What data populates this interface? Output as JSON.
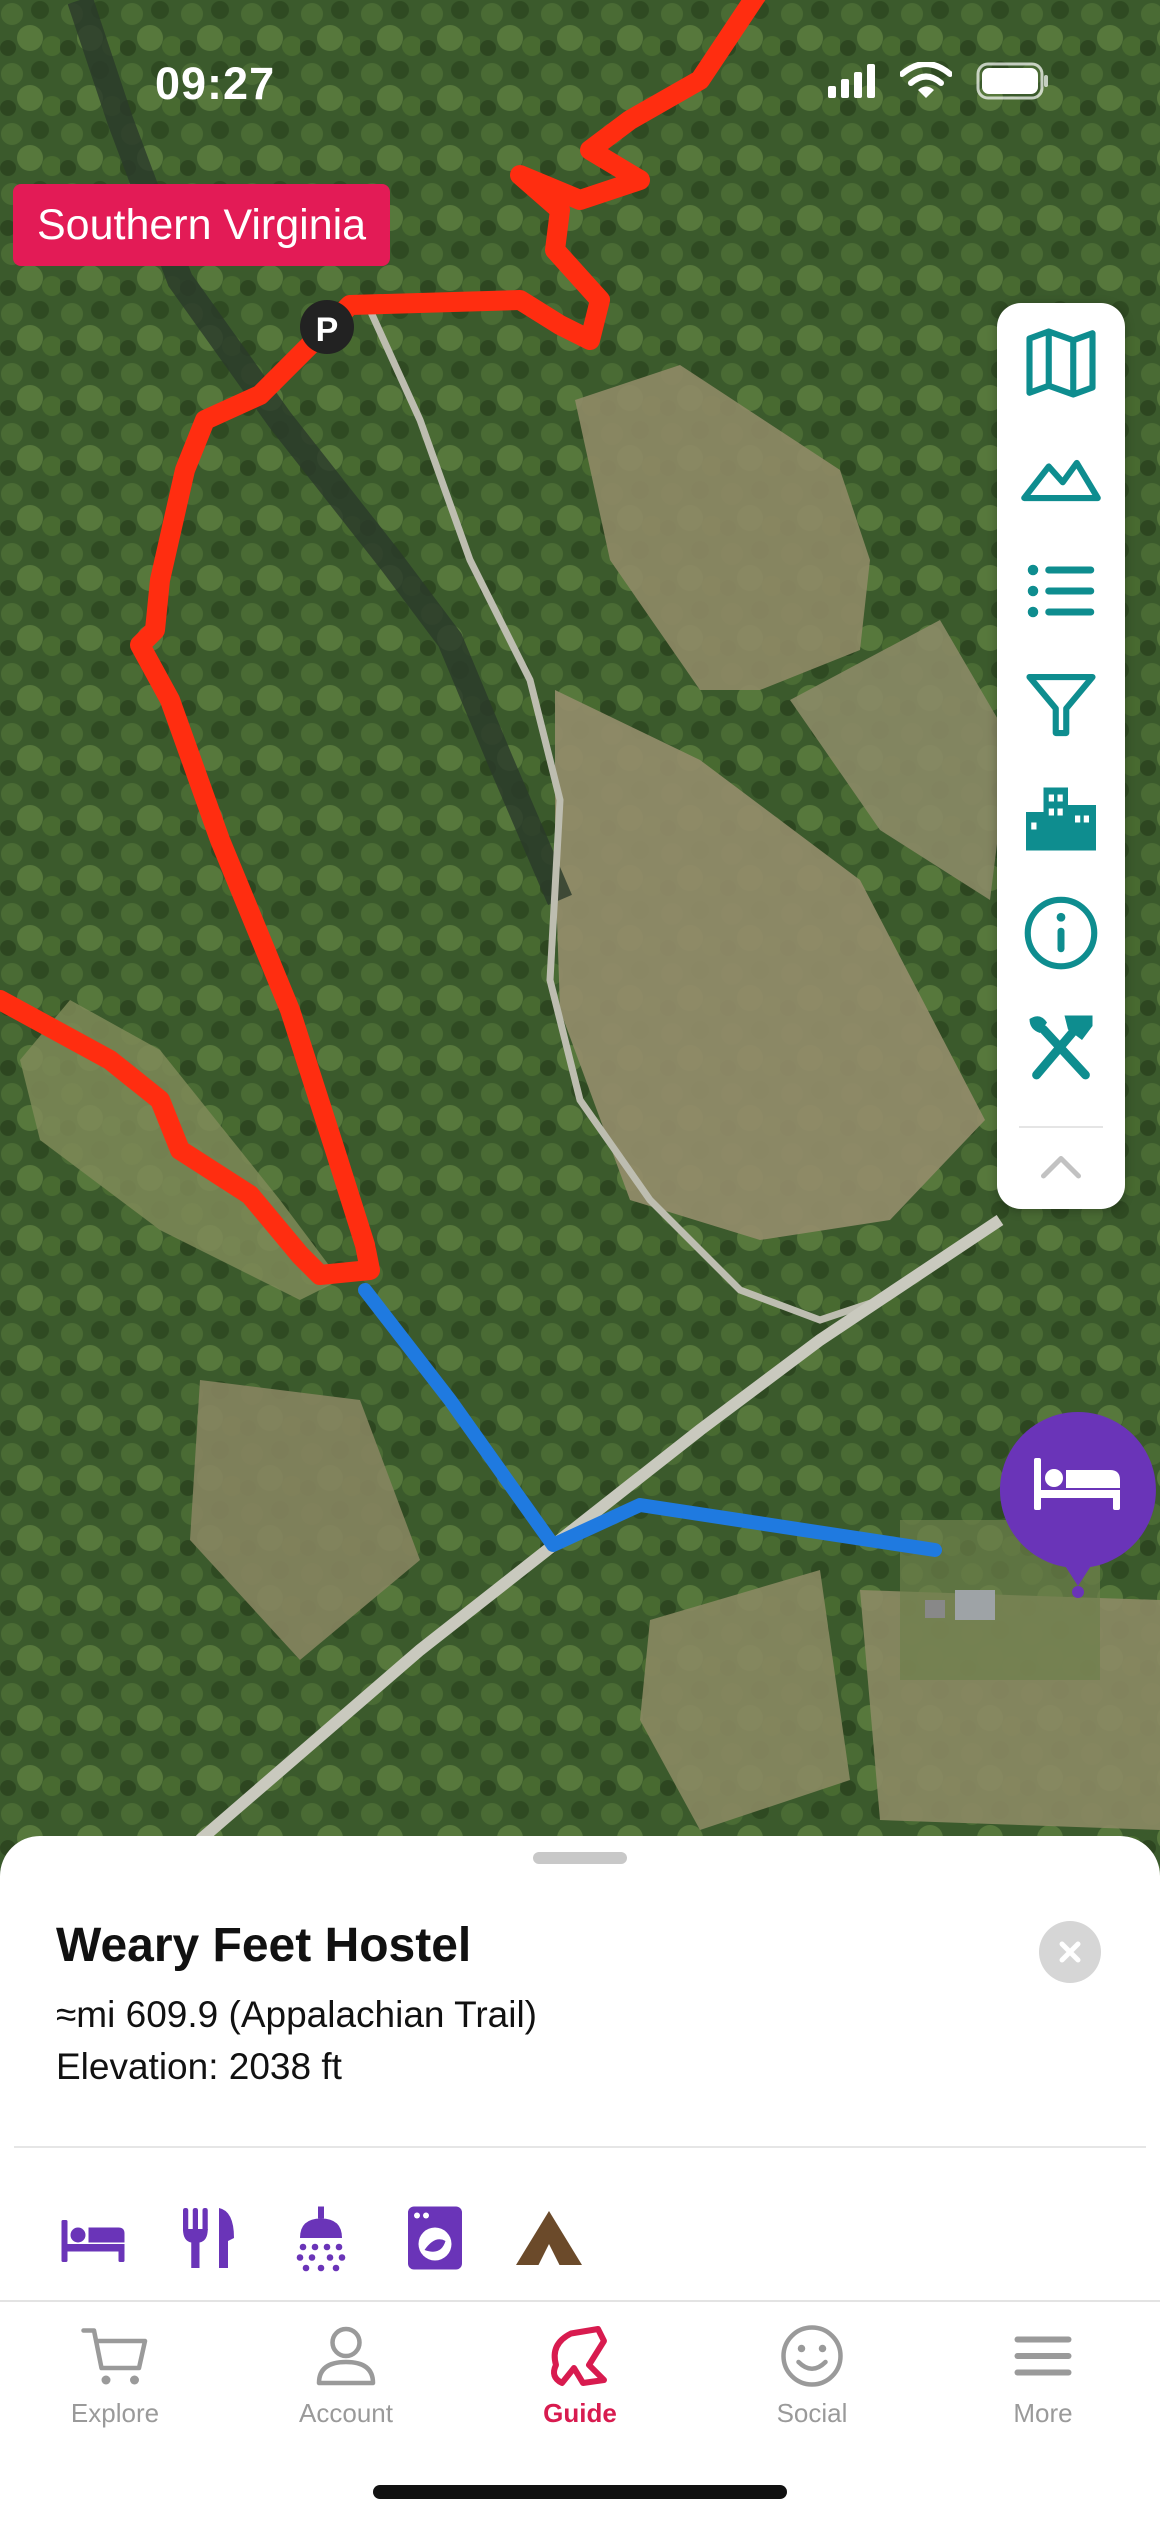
{
  "status_bar": {
    "time": "09:27"
  },
  "map": {
    "region_label": "Southern Virginia",
    "parking_marker": "P",
    "trail_color": "#ff2d10",
    "route_color": "#1f7ae0",
    "poi_pin_icon": "bed-icon",
    "poi_pin_color": "#6a34b8"
  },
  "toolbar": {
    "items": [
      "map-icon",
      "elevation-icon",
      "list-icon",
      "filter-icon",
      "buildings-icon",
      "info-icon",
      "tools-icon",
      "chevron-up-icon"
    ],
    "color": "#0e8d8f"
  },
  "poi": {
    "title": "Weary Feet Hostel",
    "mile": "≈mi 609.9 (Appalachian Trail)",
    "elevation": "Elevation: 2038 ft",
    "amenities": [
      "bed-icon",
      "fork-knife-icon",
      "shower-icon",
      "laundry-icon",
      "tent-icon"
    ],
    "amenity_color": "#6a34b8",
    "tent_color": "#6b4a2a"
  },
  "tabbar": {
    "tabs": [
      {
        "label": "Explore",
        "icon": "cart-icon"
      },
      {
        "label": "Account",
        "icon": "person-icon"
      },
      {
        "label": "Guide",
        "icon": "guide-logo-icon"
      },
      {
        "label": "Social",
        "icon": "smiley-icon"
      },
      {
        "label": "More",
        "icon": "menu-icon"
      }
    ],
    "active": "Guide",
    "active_color": "#d81b4f"
  }
}
